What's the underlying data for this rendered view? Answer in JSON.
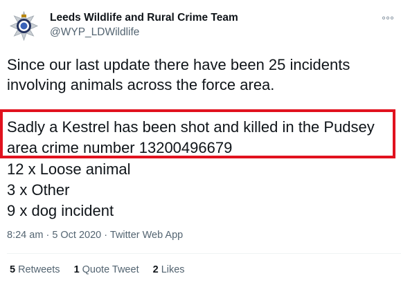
{
  "author": {
    "name": "Leeds Wildlife and Rural Crime Team",
    "handle": "@WYP_LDWildlife",
    "avatar_icon": "police-crest-icon"
  },
  "tweet": {
    "paragraph1": [
      "Since our last update there have been 25 incidents",
      "involving animals across the force area."
    ],
    "highlight": [
      "Sadly a Kestrel has been shot and killed in the Pudsey",
      "area crime number 13200496679"
    ],
    "list": [
      "12 x Loose animal",
      "3 x Other",
      "9 x dog incident"
    ]
  },
  "meta": {
    "time": "8:24 am",
    "separator": "·",
    "date": "5 Oct 2020",
    "source": "Twitter Web App"
  },
  "stats": {
    "retweets_count": "5",
    "retweets_label": "Retweets",
    "quote_count": "1",
    "quote_label": "Quote Tweet",
    "likes_count": "2",
    "likes_label": "Likes"
  },
  "colors": {
    "highlight_border": "#e1121e",
    "secondary_text": "#536471",
    "primary_text": "#0f1419"
  }
}
